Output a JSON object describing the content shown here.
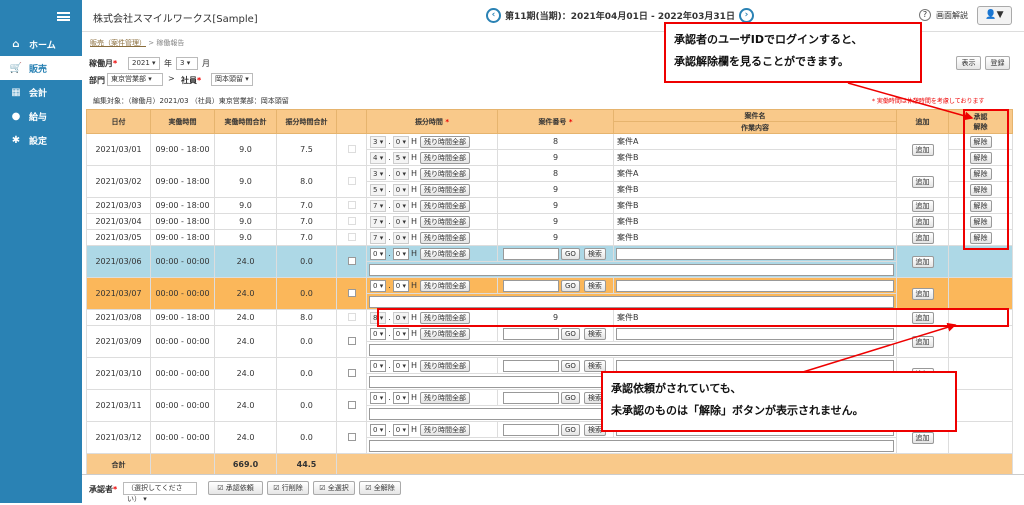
{
  "sidebar": {
    "items": [
      {
        "label": "ホーム",
        "icon": "home-icon"
      },
      {
        "label": "販売",
        "icon": "cart-icon"
      },
      {
        "label": "会計",
        "icon": "calculator-icon"
      },
      {
        "label": "給与",
        "icon": "money-bag-icon"
      },
      {
        "label": "設定",
        "icon": "gear-icon"
      }
    ]
  },
  "header": {
    "company": "株式会社スマイルワークス[Sample]",
    "period": "第11期(当期)：2021年04月01日 - 2022年03月31日",
    "help": "画面解説",
    "user_icon": "▼"
  },
  "breadcrumb": {
    "parent": "販売（案件管理）",
    "sep": ">",
    "current": "稼働報告"
  },
  "filters": {
    "month_label": "稼働月",
    "year": "2021",
    "year_unit": "年",
    "month": "3",
    "month_unit": "月",
    "dept_label": "部門",
    "dept": "東京営業部",
    "person_label": "社員",
    "person": "岡本頭留"
  },
  "buttons": {
    "show": "表示",
    "register": "登録"
  },
  "edit_target": "編集対象：（稼働月）2021/03 （社員）東京営業部：岡本頭留",
  "note": "* 実働時間は休憩時間を考慮しております",
  "columns": {
    "date": "日付",
    "actual": "実働時間",
    "actual_total": "実働時間合計",
    "alloc_total": "振分時間合計",
    "alloc": "振分時間",
    "proj_no": "案件番号",
    "proj_name": "案件名",
    "work": "作業内容",
    "add": "追加",
    "approve": "承認",
    "release": "解除"
  },
  "labels": {
    "remaining": "残り時間全部",
    "h": "H",
    "add": "追加",
    "release": "解除",
    "go": "GO",
    "search": "検索"
  },
  "rows": [
    {
      "date": "2021/03/01",
      "actual": "09:00 - 18:00",
      "total": "9.0",
      "alloc": "7.5",
      "subs": [
        {
          "h": "3",
          "m": "0",
          "no": "8",
          "name": "案件A"
        },
        {
          "h": "4",
          "m": "5",
          "no": "9",
          "name": "案件B"
        }
      ]
    },
    {
      "date": "2021/03/02",
      "actual": "09:00 - 18:00",
      "total": "9.0",
      "alloc": "8.0",
      "subs": [
        {
          "h": "3",
          "m": "0",
          "no": "8",
          "name": "案件A"
        },
        {
          "h": "5",
          "m": "0",
          "no": "9",
          "name": "案件B"
        }
      ]
    },
    {
      "date": "2021/03/03",
      "actual": "09:00 - 18:00",
      "total": "9.0",
      "alloc": "7.0",
      "subs": [
        {
          "h": "7",
          "m": "0",
          "no": "9",
          "name": "案件B"
        }
      ]
    },
    {
      "date": "2021/03/04",
      "actual": "09:00 - 18:00",
      "total": "9.0",
      "alloc": "7.0",
      "subs": [
        {
          "h": "7",
          "m": "0",
          "no": "9",
          "name": "案件B"
        }
      ]
    },
    {
      "date": "2021/03/05",
      "actual": "09:00 - 18:00",
      "total": "9.0",
      "alloc": "7.0",
      "subs": [
        {
          "h": "7",
          "m": "0",
          "no": "9",
          "name": "案件B"
        }
      ]
    },
    {
      "date": "2021/03/06",
      "actual": "00:00 - 00:00",
      "total": "24.0",
      "alloc": "0.0",
      "subs": [
        {
          "h": "0",
          "m": "0"
        }
      ]
    },
    {
      "date": "2021/03/07",
      "actual": "00:00 - 00:00",
      "total": "24.0",
      "alloc": "0.0",
      "subs": [
        {
          "h": "0",
          "m": "0"
        }
      ]
    },
    {
      "date": "2021/03/08",
      "actual": "09:00 - 18:00",
      "total": "24.0",
      "alloc": "8.0",
      "subs": [
        {
          "h": "8",
          "m": "0",
          "no": "9",
          "name": "案件B"
        }
      ]
    },
    {
      "date": "2021/03/09",
      "actual": "00:00 - 00:00",
      "total": "24.0",
      "alloc": "0.0",
      "subs": [
        {
          "h": "0",
          "m": "0"
        }
      ]
    },
    {
      "date": "2021/03/10",
      "actual": "00:00 - 00:00",
      "total": "24.0",
      "alloc": "0.0",
      "subs": [
        {
          "h": "0",
          "m": "0"
        }
      ]
    },
    {
      "date": "2021/03/11",
      "actual": "00:00 - 00:00",
      "total": "24.0",
      "alloc": "0.0",
      "subs": [
        {
          "h": "0",
          "m": "0"
        }
      ]
    },
    {
      "date": "2021/03/12",
      "actual": "00:00 - 00:00",
      "total": "24.0",
      "alloc": "0.0",
      "subs": [
        {
          "h": "0",
          "m": "0"
        }
      ]
    }
  ],
  "totals": {
    "label": "合計",
    "actual_total": "669.0",
    "alloc_total": "44.5"
  },
  "footer": {
    "approver_label": "承認者",
    "approver_value": "（選択してください）",
    "approve_request": "承認依頼",
    "delete_row": "行削除",
    "select_all": "全選択",
    "deselect_all": "全解除"
  },
  "callouts": {
    "top_line1": "承認者のユーザIDでログインすると、",
    "top_line2": "承認解除欄を見ることができます。",
    "bottom_line1": "承認依頼がされていても、",
    "bottom_line2": "未承認のものは「解除」ボタンが表示されません。"
  }
}
